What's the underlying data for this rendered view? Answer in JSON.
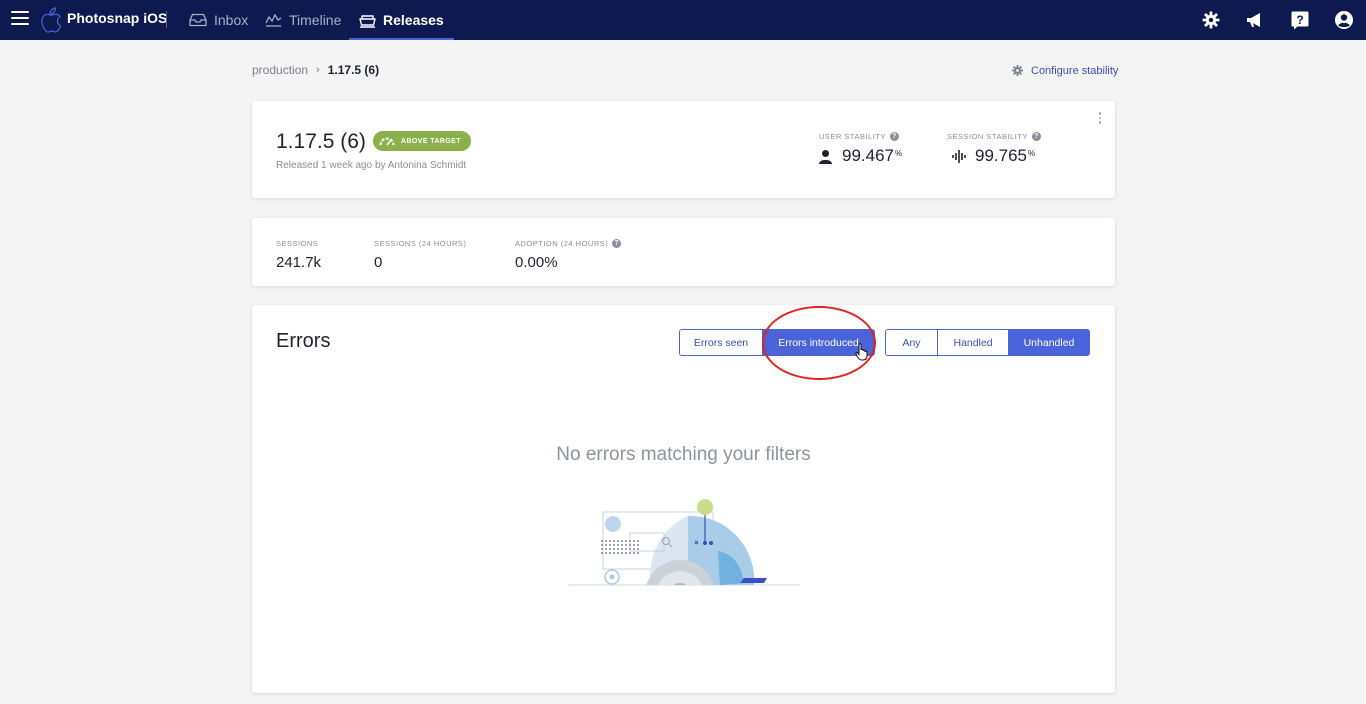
{
  "nav": {
    "app_name": "Photosnap iOS",
    "items": [
      {
        "label": "Inbox",
        "icon": "inbox-icon",
        "active": false
      },
      {
        "label": "Timeline",
        "icon": "timeline-icon",
        "active": false
      },
      {
        "label": "Releases",
        "icon": "releases-icon",
        "active": true
      }
    ],
    "right_icons": [
      "gear-icon",
      "megaphone-icon",
      "help-icon",
      "user-account-icon"
    ]
  },
  "breadcrumb": {
    "parent": "production",
    "separator": "›",
    "current": "1.17.5 (6)"
  },
  "config_link": "Configure stability",
  "release": {
    "version": "1.17.5 (6)",
    "badge": "ABOVE TARGET",
    "subtitle": "Released 1 week ago by Antonina Schmidt",
    "user_stability_label": "USER STABILITY",
    "user_stability_value": "99.467",
    "session_stability_label": "SESSION STABILITY",
    "session_stability_value": "99.765",
    "percent": "%"
  },
  "metrics": [
    {
      "label": "SESSIONS",
      "value": "241.7k"
    },
    {
      "label": "SESSIONS (24 HOURS)",
      "value": "0"
    },
    {
      "label": "ADOPTION (24 HOURS)",
      "value": "0.00%"
    }
  ],
  "errors": {
    "title": "Errors",
    "scope_tabs": [
      {
        "label": "Errors seen",
        "active": false
      },
      {
        "label": "Errors introduced",
        "active": true
      }
    ],
    "handled_tabs": [
      {
        "label": "Any",
        "active": false
      },
      {
        "label": "Handled",
        "active": false
      },
      {
        "label": "Unhandled",
        "active": true
      }
    ],
    "empty_message": "No errors matching your filters"
  },
  "colors": {
    "nav_bg": "#0e1a4f",
    "accent": "#4a63d8",
    "badge_green": "#8ab04b",
    "highlight_red": "#e0231b"
  }
}
